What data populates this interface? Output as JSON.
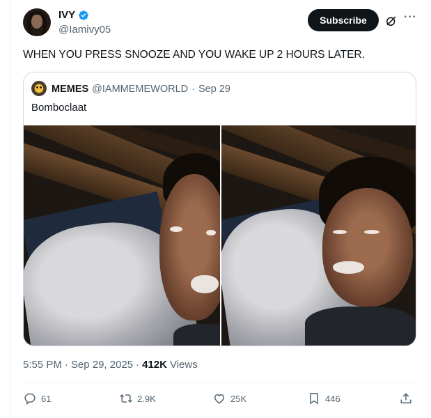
{
  "author": {
    "display_name": "IVY",
    "handle": "@Iamivy05",
    "verified_badge_icon": "verified-badge-icon"
  },
  "header": {
    "subscribe_label": "Subscribe",
    "grok_icon": "slashed-circle-icon",
    "more_icon": "more-horizontal-icon"
  },
  "tweet": {
    "text": "WHEN YOU PRESS SNOOZE AND YOU WAKE UP 2 HOURS LATER."
  },
  "quoted": {
    "display_name": "MEMES",
    "handle": "@IAMMEMEWORLD",
    "separator": "·",
    "date": "Sep 29",
    "text": "Bomboclaat",
    "media": [
      "photo-left",
      "photo-right"
    ]
  },
  "meta": {
    "time": "5:55 PM",
    "separator": "·",
    "date": "Sep 29, 2025",
    "separator2": "·",
    "views_count": "412K",
    "views_label": "Views"
  },
  "actions": {
    "replies": "61",
    "reposts": "2.9K",
    "likes": "25K",
    "bookmarks": "446"
  },
  "colors": {
    "text": "#0f1419",
    "muted": "#536471",
    "border": "#cfd9de",
    "verified": "#1d9bf0"
  }
}
